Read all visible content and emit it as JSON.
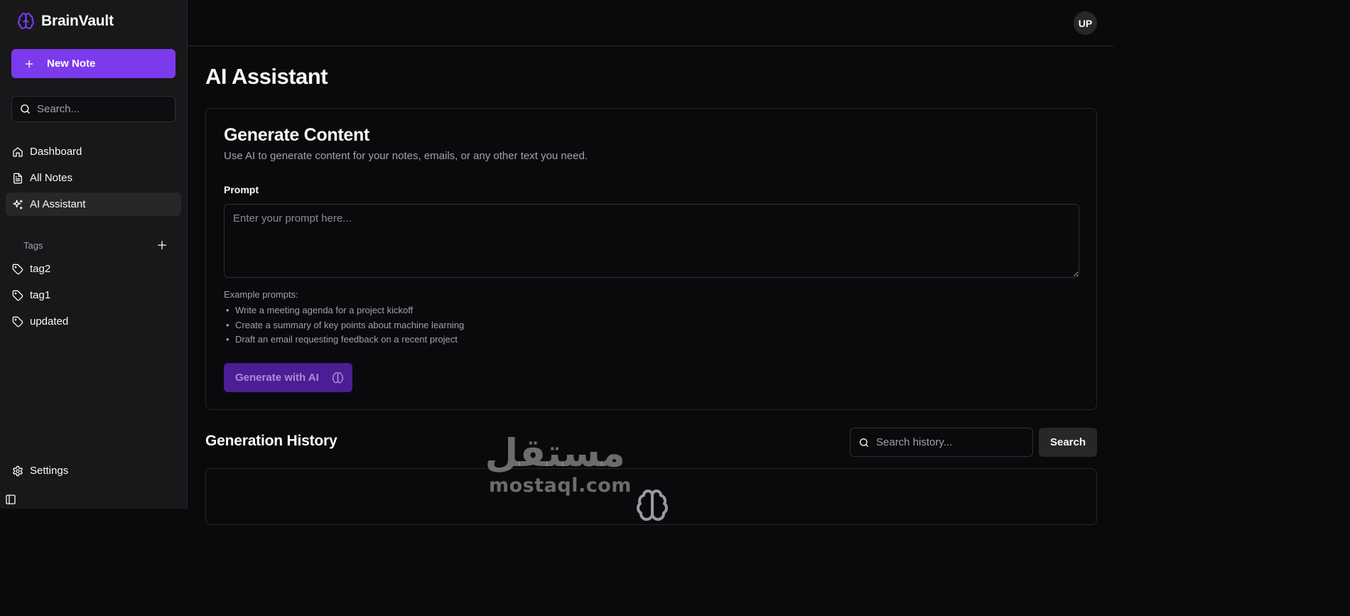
{
  "app": {
    "name": "BrainVault"
  },
  "sidebar": {
    "new_note_label": "New Note",
    "search_placeholder": "Search...",
    "nav": [
      {
        "label": "Dashboard",
        "icon": "home-icon"
      },
      {
        "label": "All Notes",
        "icon": "file-text-icon"
      },
      {
        "label": "AI Assistant",
        "icon": "sparkles-icon",
        "active": true
      }
    ],
    "tags_label": "Tags",
    "tags": [
      {
        "label": "tag2",
        "icon": "tag-icon"
      },
      {
        "label": "tag1",
        "icon": "tag-icon"
      },
      {
        "label": "updated",
        "icon": "tag-icon"
      }
    ],
    "settings_label": "Settings"
  },
  "header": {
    "avatar_initials": "UP"
  },
  "main": {
    "title": "AI Assistant",
    "generate": {
      "title": "Generate Content",
      "description": "Use AI to generate content for your notes, emails, or any other text you need.",
      "prompt_label": "Prompt",
      "prompt_placeholder": "Enter your prompt here...",
      "prompt_value": "",
      "examples_title": "Example prompts:",
      "examples": [
        "Write a meeting agenda for a project kickoff",
        "Create a summary of key points about machine learning",
        "Draft an email requesting feedback on a recent project"
      ],
      "button_label": "Generate with AI"
    },
    "history": {
      "title": "Generation History",
      "search_placeholder": "Search history...",
      "search_button": "Search"
    }
  },
  "watermark": {
    "arabic": "مستقل",
    "latin": "mostaql.com"
  },
  "colors": {
    "accent": "#7c3aed",
    "accent_disabled": "#4c1d95",
    "background": "#0a0a0c",
    "sidebar": "#18181b"
  }
}
